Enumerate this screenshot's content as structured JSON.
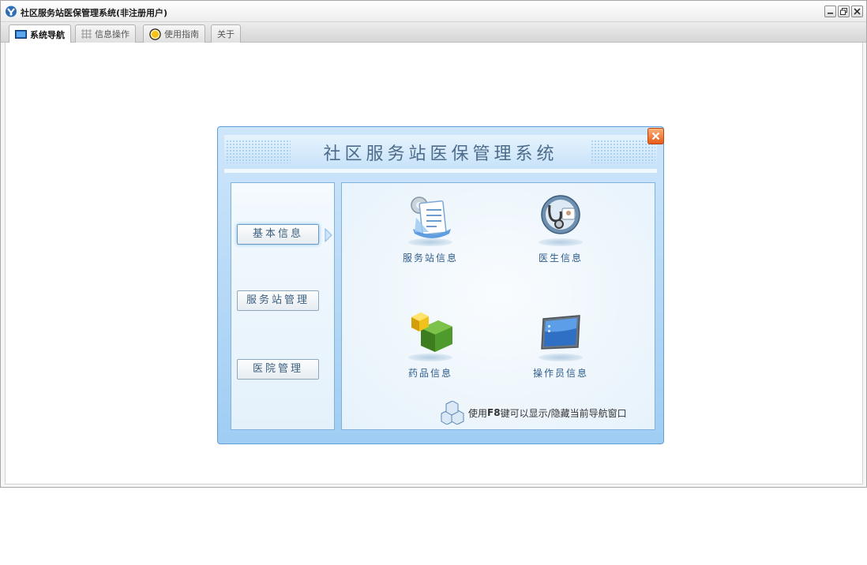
{
  "window": {
    "title": "社区服务站医保管理系统(非注册用户)"
  },
  "tabs": [
    {
      "label": "系统导航",
      "icon": "monitor-icon",
      "active": true
    },
    {
      "label": "信息操作",
      "icon": "grid-icon",
      "active": false
    },
    {
      "label": "使用指南",
      "icon": "help-globe-icon",
      "active": false
    },
    {
      "label": "关于",
      "icon": "",
      "active": false
    }
  ],
  "dialog": {
    "title": "社区服务站医保管理系统",
    "nav": [
      {
        "label": "基本信息",
        "selected": true
      },
      {
        "label": "服务站管理",
        "selected": false
      },
      {
        "label": "医院管理",
        "selected": false
      }
    ],
    "tiles": [
      {
        "label": "服务站信息",
        "icon": "document-gear-icon"
      },
      {
        "label": "医生信息",
        "icon": "stethoscope-icon"
      },
      {
        "label": "药品信息",
        "icon": "medicine-cubes-icon"
      },
      {
        "label": "操作员信息",
        "icon": "laptop-screen-icon"
      }
    ],
    "hint": {
      "prefix": "使用",
      "key": "F8",
      "suffix": "键可以显示/隐藏当前导航窗口"
    }
  },
  "colors": {
    "dialog_border": "#5e9fd9",
    "dialog_title": "#4d6b8a",
    "tile_label": "#2f5d8b",
    "close_button": "#e65a16"
  }
}
